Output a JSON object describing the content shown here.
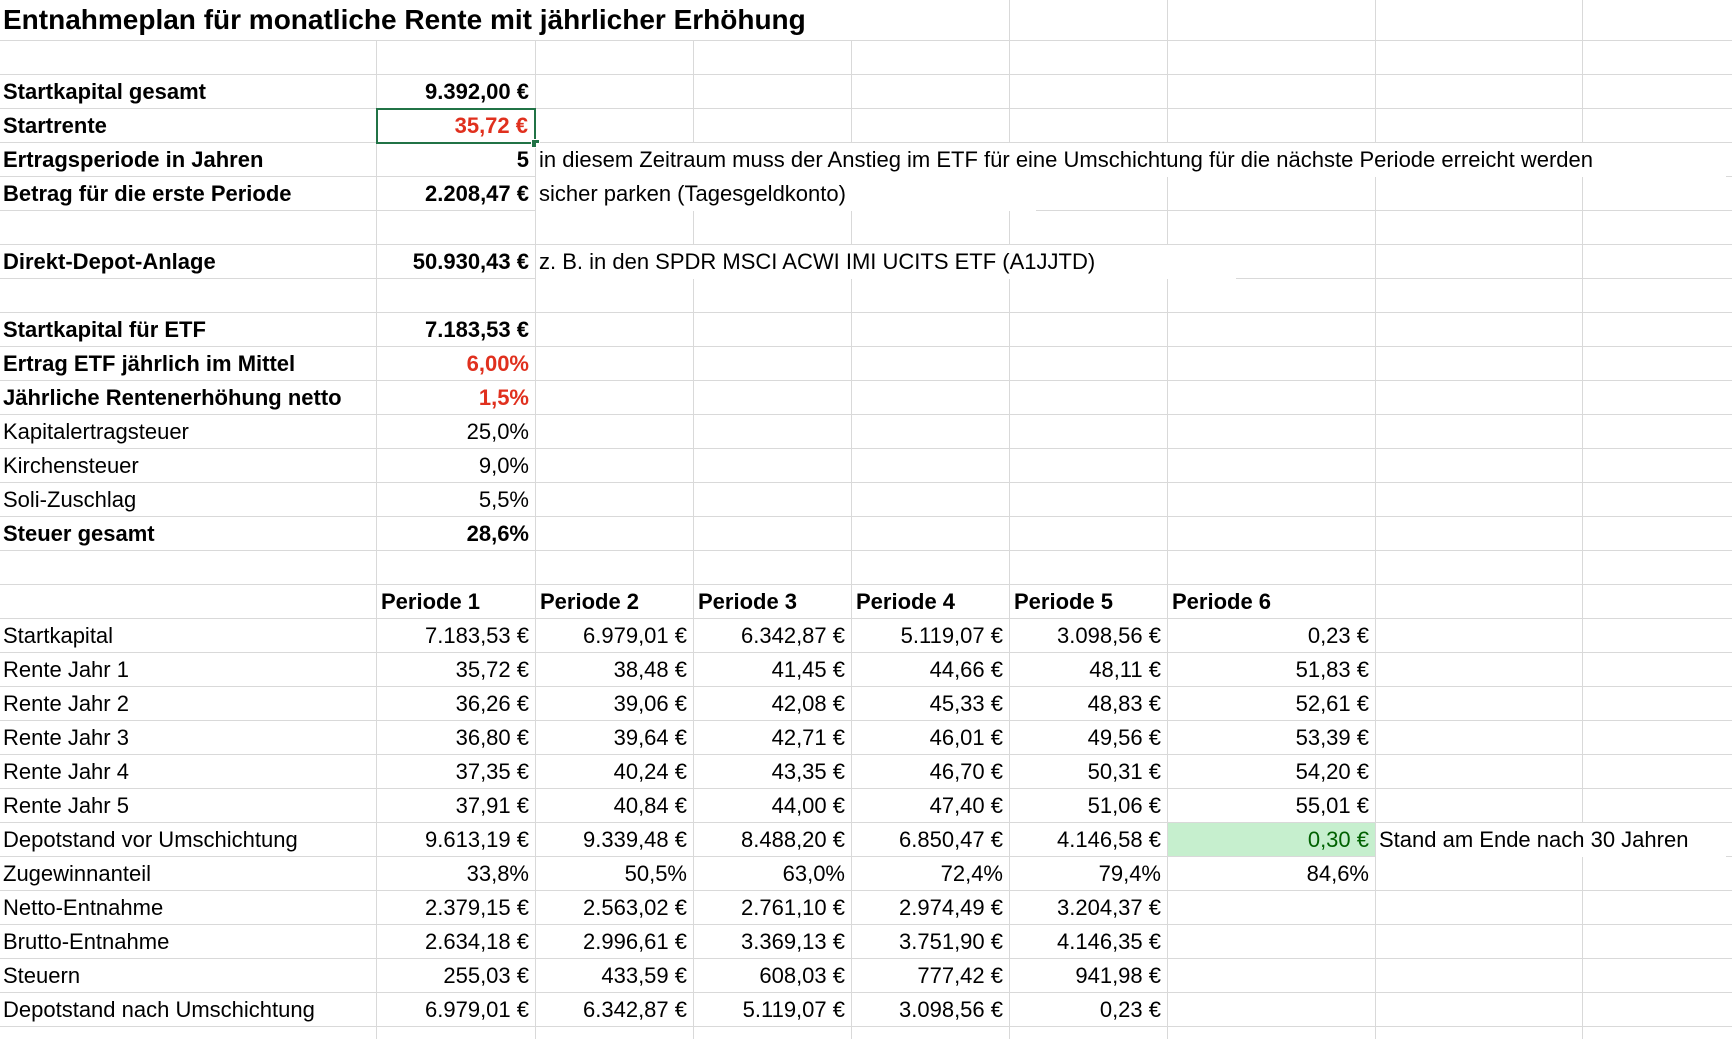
{
  "title": "Entnahmeplan für monatliche Rente mit jährlicher Erhöhung",
  "params": {
    "startkapital": {
      "label": "Startkapital gesamt",
      "value": "9.392,00 €"
    },
    "startrente": {
      "label": "Startrente",
      "value": "35,72 €"
    },
    "ertragsperiode": {
      "label": "Ertragsperiode in Jahren",
      "value": "5",
      "note": "in diesem Zeitraum muss der Anstieg im ETF für eine Umschichtung für die nächste Periode erreicht werden"
    },
    "betrag": {
      "label": "Betrag für die erste Periode",
      "value": "2.208,47 €",
      "note": "sicher parken (Tagesgeldkonto)"
    },
    "direkt": {
      "label": "Direkt-Depot-Anlage",
      "value": "50.930,43 €",
      "note": "z. B. in den SPDR MSCI ACWI IMI UCITS ETF (A1JJTD)"
    },
    "startetf": {
      "label": "Startkapital für ETF",
      "value": "7.183,53 €"
    },
    "ertrag": {
      "label": "Ertrag ETF jährlich im Mittel",
      "value": "6,00%"
    },
    "erhoehung": {
      "label": "Jährliche Rentenerhöhung netto",
      "value": "1,5%"
    },
    "kest": {
      "label": "Kapitalertragsteuer",
      "value": "25,0%"
    },
    "kirche": {
      "label": "Kirchensteuer",
      "value": "9,0%"
    },
    "soli": {
      "label": "Soli-Zuschlag",
      "value": "5,5%"
    },
    "steuer": {
      "label": "Steuer gesamt",
      "value": "28,6%"
    }
  },
  "table": {
    "headers": [
      "Periode 1",
      "Periode 2",
      "Periode 3",
      "Periode 4",
      "Periode 5",
      "Periode 6"
    ],
    "rows": [
      {
        "label": "Startkapital",
        "values": [
          "7.183,53 €",
          "6.979,01 €",
          "6.342,87 €",
          "5.119,07 €",
          "3.098,56 €",
          "0,23 €"
        ]
      },
      {
        "label": "Rente Jahr 1",
        "values": [
          "35,72 €",
          "38,48 €",
          "41,45 €",
          "44,66 €",
          "48,11 €",
          "51,83 €"
        ]
      },
      {
        "label": "Rente Jahr 2",
        "values": [
          "36,26 €",
          "39,06 €",
          "42,08 €",
          "45,33 €",
          "48,83 €",
          "52,61 €"
        ]
      },
      {
        "label": "Rente Jahr 3",
        "values": [
          "36,80 €",
          "39,64 €",
          "42,71 €",
          "46,01 €",
          "49,56 €",
          "53,39 €"
        ]
      },
      {
        "label": "Rente Jahr 4",
        "values": [
          "37,35 €",
          "40,24 €",
          "43,35 €",
          "46,70 €",
          "50,31 €",
          "54,20 €"
        ]
      },
      {
        "label": "Rente Jahr 5",
        "values": [
          "37,91 €",
          "40,84 €",
          "44,00 €",
          "47,40 €",
          "51,06 €",
          "55,01 €"
        ]
      },
      {
        "label": "Depotstand vor Umschichtung",
        "values": [
          "9.613,19 €",
          "9.339,48 €",
          "8.488,20 €",
          "6.850,47 €",
          "4.146,58 €",
          "0,30 €"
        ],
        "note": "Stand am Ende nach 30 Jahren"
      },
      {
        "label": "Zugewinnanteil",
        "values": [
          "33,8%",
          "50,5%",
          "63,0%",
          "72,4%",
          "79,4%",
          "84,6%"
        ]
      },
      {
        "label": "Netto-Entnahme",
        "values": [
          "2.379,15 €",
          "2.563,02 €",
          "2.761,10 €",
          "2.974,49 €",
          "3.204,37 €",
          ""
        ]
      },
      {
        "label": "Brutto-Entnahme",
        "values": [
          "2.634,18 €",
          "2.996,61 €",
          "3.369,13 €",
          "3.751,90 €",
          "4.146,35 €",
          ""
        ]
      },
      {
        "label": "Steuern",
        "values": [
          "255,03 €",
          "433,59 €",
          "608,03 €",
          "777,42 €",
          "941,98 €",
          ""
        ]
      },
      {
        "label": "Depotstand nach Umschichtung",
        "values": [
          "6.979,01 €",
          "6.342,87 €",
          "5.119,07 €",
          "3.098,56 €",
          "0,23 €",
          ""
        ]
      }
    ]
  },
  "colors": {
    "accent_red": "#e0301e",
    "highlight_green": "#c6efce",
    "selection": "#217346"
  }
}
